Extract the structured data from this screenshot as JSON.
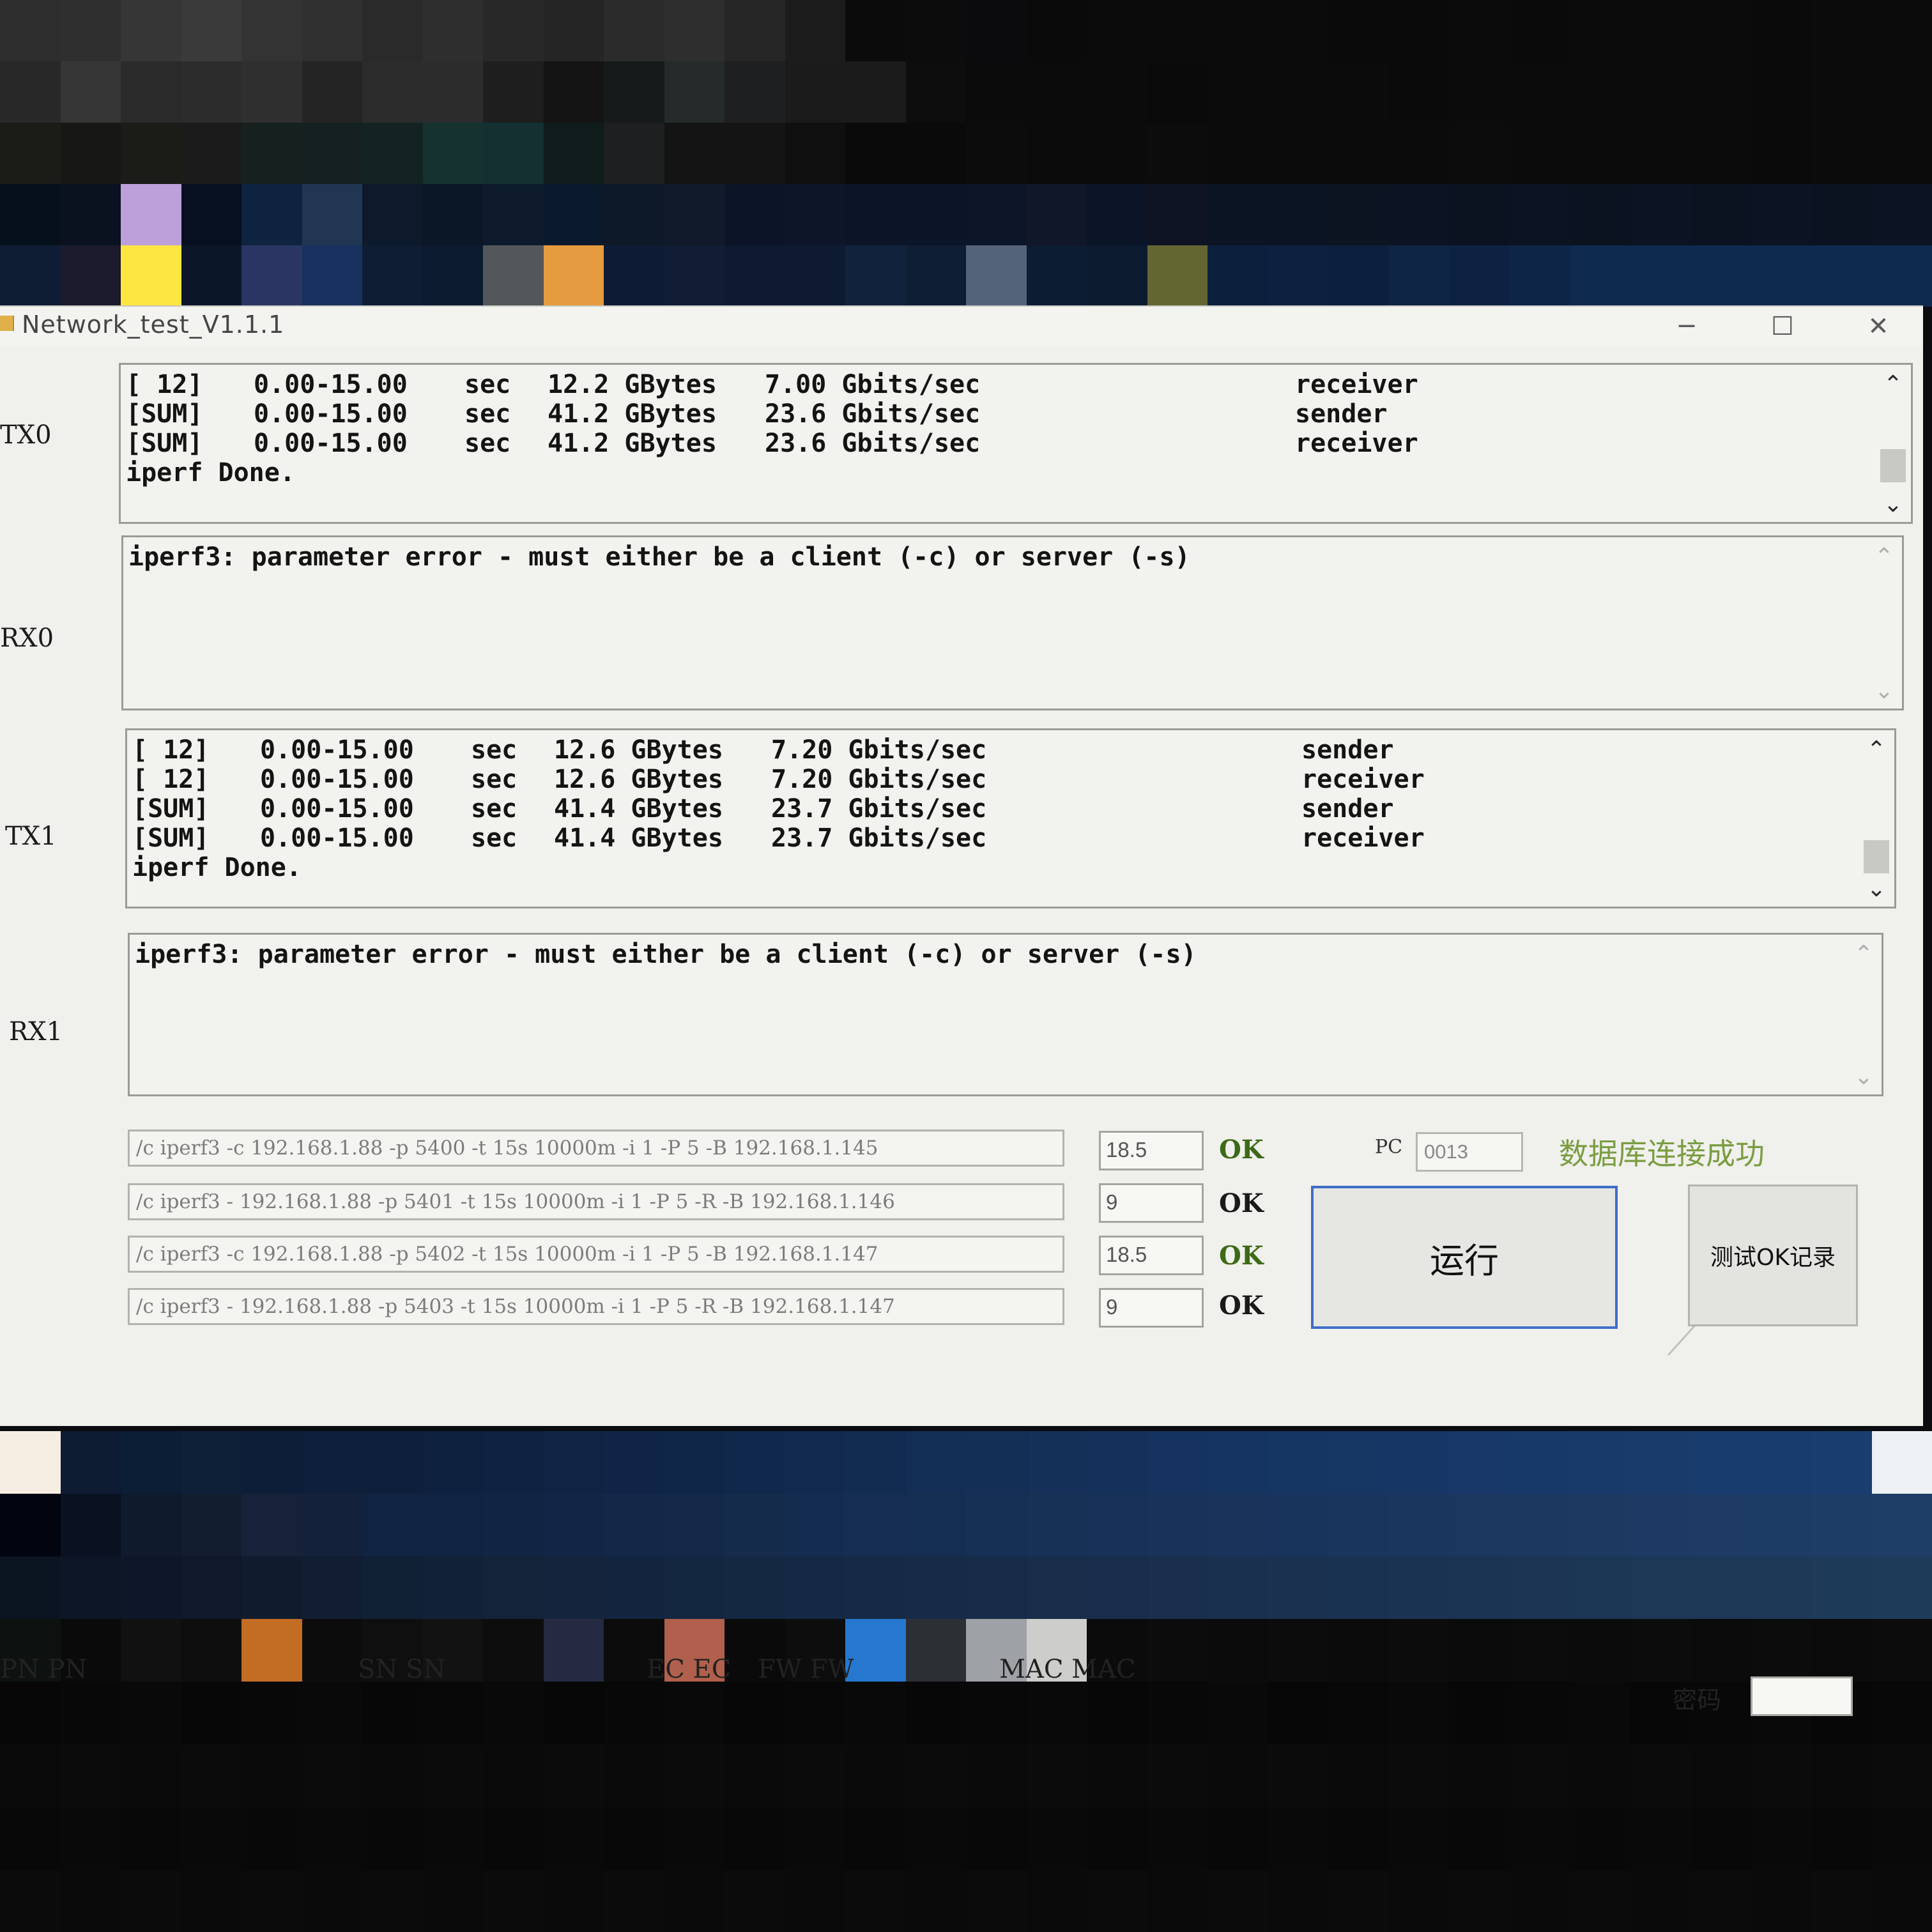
{
  "window": {
    "title": "Network_test_V1.1.1",
    "controls": {
      "minimize": "─",
      "maximize": "☐",
      "close": "✕"
    }
  },
  "side_labels": {
    "tx0": "TX0",
    "rx0": "RX0",
    "tx1": "TX1",
    "rx1": "RX1"
  },
  "tx0_log": {
    "rows": [
      {
        "id": "[ 12]",
        "interval": "0.00-15.00",
        "unit": "sec",
        "transfer": "12.2 GBytes",
        "bitrate": "7.00 Gbits/sec",
        "role": "receiver"
      },
      {
        "id": "[SUM]",
        "interval": "0.00-15.00",
        "unit": "sec",
        "transfer": "41.2 GBytes",
        "bitrate": "23.6 Gbits/sec",
        "role": "sender"
      },
      {
        "id": "[SUM]",
        "interval": "0.00-15.00",
        "unit": "sec",
        "transfer": "41.2 GBytes",
        "bitrate": "23.6 Gbits/sec",
        "role": "receiver"
      }
    ],
    "footer": "iperf Done."
  },
  "rx0_log": {
    "text": "iperf3: parameter error - must either be a client (-c) or server (-s)"
  },
  "tx1_log": {
    "rows": [
      {
        "id": "[ 12]",
        "interval": "0.00-15.00",
        "unit": "sec",
        "transfer": "12.6 GBytes",
        "bitrate": "7.20 Gbits/sec",
        "role": "sender"
      },
      {
        "id": "[ 12]",
        "interval": "0.00-15.00",
        "unit": "sec",
        "transfer": "12.6 GBytes",
        "bitrate": "7.20 Gbits/sec",
        "role": "receiver"
      },
      {
        "id": "[SUM]",
        "interval": "0.00-15.00",
        "unit": "sec",
        "transfer": "41.4 GBytes",
        "bitrate": "23.7 Gbits/sec",
        "role": "sender"
      },
      {
        "id": "[SUM]",
        "interval": "0.00-15.00",
        "unit": "sec",
        "transfer": "41.4 GBytes",
        "bitrate": "23.7 Gbits/sec",
        "role": "receiver"
      }
    ],
    "footer": "iperf Done."
  },
  "rx1_log": {
    "text": "iperf3: parameter error - must either be a client (-c) or server (-s)"
  },
  "commands": [
    {
      "cmd": "/c iperf3 -c 192.168.1.88 -p 5400 -t 15s 10000m -i 1 -P 5 -B 192.168.1.145",
      "value": "18.5",
      "status": "OK",
      "status_color": "#3c6a16"
    },
    {
      "cmd": "/c iperf3 - 192.168.1.88 -p 5401 -t 15s 10000m -i 1 -P 5 -R -B 192.168.1.146",
      "value": "9",
      "status": "OK",
      "status_color": "#1a1a1a"
    },
    {
      "cmd": "/c iperf3 -c 192.168.1.88 -p 5402 -t 15s 10000m -i 1 -P 5 -B 192.168.1.147",
      "value": "18.5",
      "status": "OK",
      "status_color": "#3c6a16"
    },
    {
      "cmd": "/c iperf3 - 192.168.1.88 -p 5403 -t 15s 10000m -i 1 -P 5 -R -B 192.168.1.147",
      "value": "9",
      "status": "OK",
      "status_color": "#1a1a1a"
    }
  ],
  "pc": {
    "label": "PC",
    "value": "0013"
  },
  "db_status": {
    "text": "数据库连接成功",
    "color": "#7b9d42"
  },
  "buttons": {
    "run": "运行",
    "ok_record": "测试OK记录"
  },
  "info_labels": {
    "pn": "PN PN",
    "sn": "SN SN",
    "ec": "EC EC",
    "fw": "FW FW",
    "mac": "MAC MAC"
  },
  "password": {
    "label": "密码",
    "value": ""
  },
  "colors": {
    "accent_button_border": "#3f6ec9",
    "window_bg": "#f0f0ec"
  }
}
